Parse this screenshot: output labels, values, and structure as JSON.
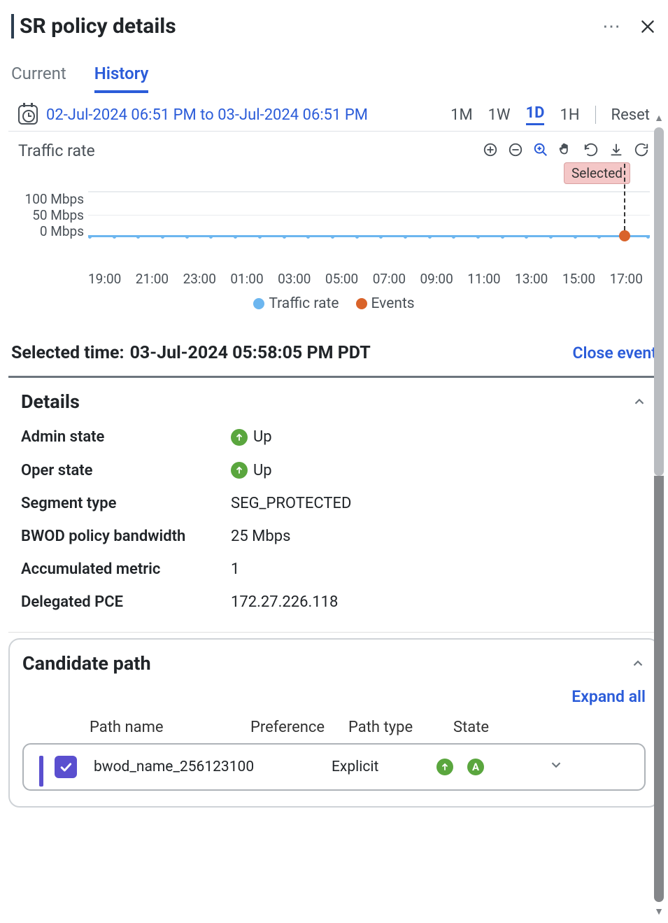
{
  "header": {
    "title": "SR policy details"
  },
  "tabs": {
    "current": "Current",
    "history": "History",
    "active": "history"
  },
  "range": {
    "text": "02-Jul-2024 06:51 PM to 03-Jul-2024 06:51 PM",
    "presets": {
      "m1": "1M",
      "w1": "1W",
      "d1": "1D",
      "h1": "1H"
    },
    "active_preset": "1D",
    "reset": "Reset"
  },
  "chart": {
    "title": "Traffic rate",
    "selected_badge": "Selected",
    "y_ticks": [
      "100 Mbps",
      "50 Mbps",
      "0 Mbps"
    ],
    "legend": {
      "traffic": "Traffic rate",
      "events": "Events"
    }
  },
  "chart_data": {
    "type": "line",
    "title": "Traffic rate",
    "xlabel": "",
    "ylabel": "Mbps",
    "ylim": [
      0,
      100
    ],
    "x_ticks": [
      "19:00",
      "21:00",
      "23:00",
      "01:00",
      "03:00",
      "05:00",
      "07:00",
      "09:00",
      "11:00",
      "13:00",
      "15:00",
      "17:00"
    ],
    "series": [
      {
        "name": "Traffic rate",
        "color": "#6cb6ef",
        "values": [
          0,
          0,
          0,
          0,
          0,
          0,
          0,
          0,
          0,
          0,
          0,
          0
        ]
      }
    ],
    "events": [
      {
        "x": "17:58",
        "label": "Selected",
        "color": "#d9632a"
      }
    ],
    "legend": [
      "Traffic rate",
      "Events"
    ]
  },
  "selected": {
    "label_prefix": "Selected time:",
    "value": "03-Jul-2024 05:58:05 PM PDT",
    "close": "Close event"
  },
  "details": {
    "title": "Details",
    "rows": {
      "admin_state_k": "Admin state",
      "admin_state_v": "Up",
      "oper_state_k": "Oper state",
      "oper_state_v": "Up",
      "segment_type_k": "Segment type",
      "segment_type_v": "SEG_PROTECTED",
      "bwod_bw_k": "BWOD policy bandwidth",
      "bwod_bw_v": "25 Mbps",
      "acc_metric_k": "Accumulated metric",
      "acc_metric_v": "1",
      "delegated_pce_k": "Delegated PCE",
      "delegated_pce_v": "172.27.226.118"
    }
  },
  "candidate": {
    "title": "Candidate path",
    "expand_all": "Expand all",
    "columns": {
      "name": "Path name",
      "pref": "Preference",
      "type": "Path type",
      "state": "State"
    },
    "rows": [
      {
        "name": "bwod_name_256123100",
        "pref": "",
        "type": "Explicit",
        "state_up": true,
        "state_active": true
      }
    ]
  }
}
